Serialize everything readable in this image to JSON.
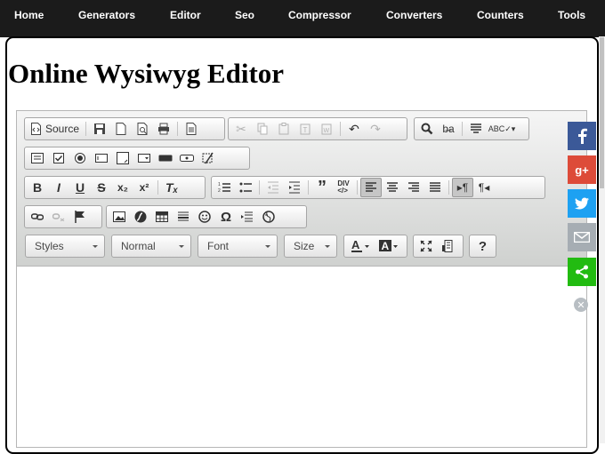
{
  "nav": {
    "items": [
      {
        "label": "Home"
      },
      {
        "label": "Generators"
      },
      {
        "label": "Editor"
      },
      {
        "label": "Seo"
      },
      {
        "label": "Compressor"
      },
      {
        "label": "Converters"
      },
      {
        "label": "Counters"
      },
      {
        "label": "Tools"
      }
    ]
  },
  "page": {
    "title": "Online Wysiwyg Editor"
  },
  "editor": {
    "source_label": "Source",
    "styles_label": "Styles",
    "format_label": "Normal",
    "font_label": "Font",
    "size_label": "Size",
    "help_label": "?"
  },
  "icons": {
    "text_color": "text-color-icon",
    "background_color": "background-color-icon"
  },
  "share": {
    "facebook_color": "#3b5998",
    "googleplus_color": "#dd4b39",
    "twitter_color": "#1da1f2",
    "email_color": "#a6adb3",
    "sharethis_color": "#22bb11"
  }
}
